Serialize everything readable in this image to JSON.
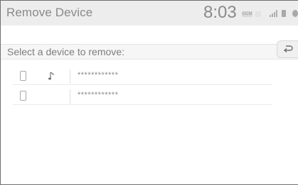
{
  "header": {
    "title": "Remove Device",
    "clock": "8:03",
    "status_indicator_label": "GCM"
  },
  "subheader": {
    "prompt": "Select a device to remove:"
  },
  "back_button": {
    "icon": "back-arrow-icon"
  },
  "devices": [
    {
      "name": "************",
      "icon": "phone-icon",
      "audio": true
    },
    {
      "name": "************",
      "icon": "phone-icon",
      "audio": false
    }
  ],
  "colors": {
    "header_bg": "#ededed",
    "text_muted": "#8a8a8a",
    "border": "#6f6f6f"
  }
}
